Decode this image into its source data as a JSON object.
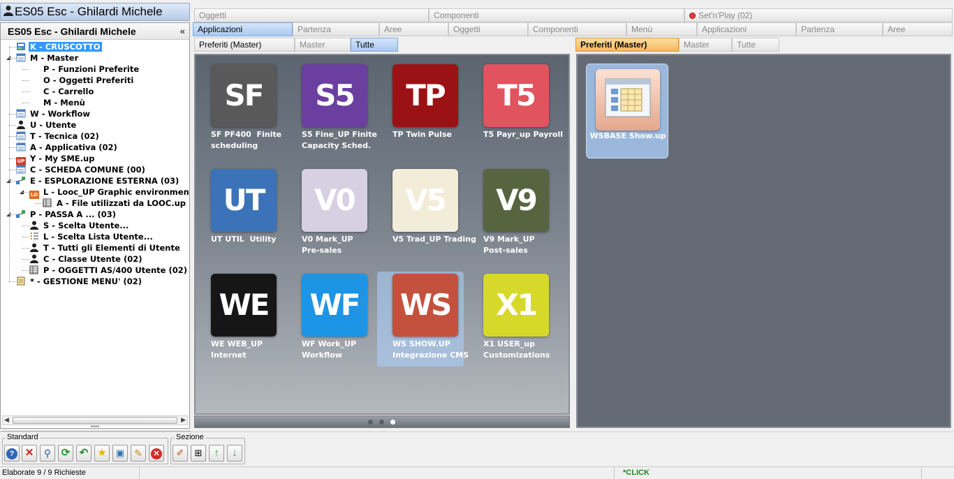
{
  "window": {
    "title": "ES05 Esc - Ghilardi Michele"
  },
  "left_panel": {
    "header": "ES05 Esc - Ghilardi Michele",
    "collapse_glyph": "«",
    "tree": [
      {
        "label": "K - CRUSCOTTO",
        "icon": "dashboard-icon",
        "selected": true
      },
      {
        "label": "M - Master",
        "icon": "list-icon"
      },
      {
        "label": "P - Funzioni Preferite"
      },
      {
        "label": "O - Oggetti Preferiti"
      },
      {
        "label": "C - Carrello"
      },
      {
        "label": "M - Menù"
      },
      {
        "label": "W - Workflow",
        "icon": "list-icon"
      },
      {
        "label": "U - Utente",
        "icon": "user-icon"
      },
      {
        "label": "T - Tecnica (02)",
        "icon": "list-icon"
      },
      {
        "label": "A - Applicativa (02)",
        "icon": "list-icon"
      },
      {
        "label": "Y - My SME.up",
        "icon": "up-badge-icon",
        "badge": "UP"
      },
      {
        "label": "C - SCHEDA COMUNE (00)",
        "icon": "list-icon"
      },
      {
        "label": "E - ESPLORAZIONE ESTERNA (03)",
        "icon": "network-icon"
      },
      {
        "label": "L - Looc_UP Graphic environment",
        "icon": "lo-badge-icon",
        "badge": "LO"
      },
      {
        "label": "A - File utilizzati da LOOC.up",
        "icon": "table-icon"
      },
      {
        "label": "P - PASSA A ... (03)",
        "icon": "network-icon"
      },
      {
        "label": "S - Scelta Utente...",
        "icon": "user-icon"
      },
      {
        "label": "L - Scelta Lista Utente...",
        "icon": "bullet-list-icon"
      },
      {
        "label": "T - Tutti gli Elementi di Utente",
        "icon": "user-icon"
      },
      {
        "label": "C - Classe Utente (02)",
        "icon": "user-icon"
      },
      {
        "label": "P - OGGETTI AS/400  Utente (02)",
        "icon": "table-icon"
      },
      {
        "label": "* - GESTIONE MENU' (02)",
        "icon": "clipboard-icon"
      }
    ]
  },
  "tabs": {
    "row1": [
      "Oggetti",
      "Componenti",
      "Set'n'Play (02)"
    ],
    "row2": [
      "Applicazioni",
      "Partenza",
      "Aree",
      "Oggetti",
      "Componenti",
      "Menù",
      "Applicazioni",
      "Partenza",
      "Aree"
    ],
    "row3_left": [
      "Preferiti (Master)",
      "Master",
      "Tutte"
    ],
    "row3_right": [
      "Preferiti (Master)",
      "Master",
      "Tutte"
    ]
  },
  "apps": [
    {
      "code": "SF",
      "label": "SF PF400  Finite\nscheduling",
      "color": "#595959"
    },
    {
      "code": "S5",
      "label": "S5 Fine_UP Finite\nCapacity Sched.",
      "color": "#6b3fa0"
    },
    {
      "code": "TP",
      "label": "TP Twin Pulse",
      "color": "#9b1214"
    },
    {
      "code": "T5",
      "label": "T5 Payr_up Payroll",
      "color": "#e1535e"
    },
    {
      "code": "UT",
      "label": "UT UTIL  Utility",
      "color": "#3c73b8"
    },
    {
      "code": "V0",
      "label": "V0 Mark_UP\nPre-sales",
      "color": "#d6d0e2"
    },
    {
      "code": "V5",
      "label": "V5 Trad_UP Trading",
      "color": "#f2ecd8"
    },
    {
      "code": "V9",
      "label": "V9 Mark_UP\nPost-sales",
      "color": "#56653f"
    },
    {
      "code": "WE",
      "label": "WE WEB_UP\nInternet",
      "color": "#161616"
    },
    {
      "code": "WF",
      "label": "WF Work_UP\nWorkflow",
      "color": "#1c95e6"
    },
    {
      "code": "WS",
      "label": "WS SHOW.UP\nIntegrazione CMS",
      "color": "#c4513d",
      "selected": true
    },
    {
      "code": "X1",
      "label": "X1 USER_up\nCustomizations",
      "color": "#d7d92a"
    }
  ],
  "pager": {
    "pages": 3,
    "current": 3
  },
  "favorites": [
    {
      "label": "WSBASE Show.up"
    }
  ],
  "toolbar": {
    "group1_label": "Standard",
    "group2_label": "Sezione"
  },
  "status": {
    "left": "Elaborate 9 / 9 Richieste",
    "click": "*CLICK"
  }
}
